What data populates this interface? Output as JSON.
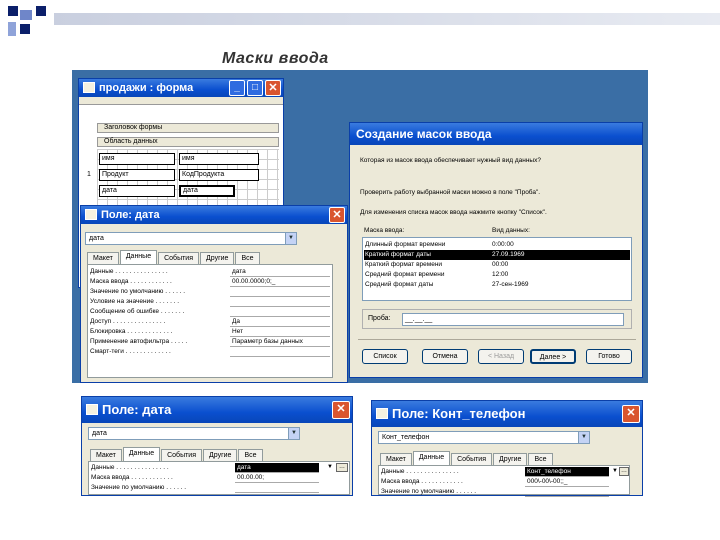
{
  "slide_title": "Маски ввода",
  "form_window": {
    "title": "продажи : форма",
    "min": "_",
    "max": "□",
    "close": "✕",
    "section_header": "Заголовок формы",
    "section_data": "Область данных",
    "rows": [
      {
        "num": "",
        "left": "имя",
        "right": "имя"
      },
      {
        "num": "1",
        "left": "Продукт",
        "right": "КодПродукта"
      },
      {
        "num": "",
        "left": "дата",
        "right": "дата"
      }
    ]
  },
  "mask_wizard": {
    "title": "Создание масок ввода",
    "question": "Которая из масок ввода обеспечивает нужный вид данных?",
    "check_text": "Проверить работу выбранной маски можно в поле \"Проба\".",
    "list_text": "Для изменения списка масок ввода нажмите кнопку \"Список\".",
    "col_mask": "Маска ввода:",
    "col_view": "Вид данных:",
    "rows": [
      {
        "mask": "Длинный формат времени",
        "view": "0:00:00",
        "selected": false
      },
      {
        "mask": "Краткий формат даты",
        "view": "27.09.1969",
        "selected": true
      },
      {
        "mask": "Краткий формат времени",
        "view": "00:00",
        "selected": false
      },
      {
        "mask": "Средний формат времени",
        "view": "12:00",
        "selected": false
      },
      {
        "mask": "Средний формат даты",
        "view": "27-сен-1969",
        "selected": false
      }
    ],
    "try_label": "Проба:",
    "try_value": "__.__.__",
    "buttons": {
      "list": "Список",
      "cancel": "Отмена",
      "back": "< Назад",
      "next": "Далее >",
      "finish": "Готово"
    }
  },
  "field_date_1": {
    "title": "Поле: дата",
    "combo": "дата",
    "tabs": [
      "Макет",
      "Данные",
      "События",
      "Другие",
      "Все"
    ],
    "active_tab": "Данные",
    "props": [
      {
        "label": "Данные . . . . . . . . . . . . . . .",
        "value": "дата"
      },
      {
        "label": "Маска ввода . . . . . . . . . . . .",
        "value": "00.00.0000;0;_"
      },
      {
        "label": "Значение по умолчанию . . . . . .",
        "value": ""
      },
      {
        "label": "Условие на значение . . . . . . .",
        "value": ""
      },
      {
        "label": "Сообщение об ошибке . . . . . . .",
        "value": ""
      },
      {
        "label": "Доступ . . . . . . . . . . . . . . .",
        "value": "Да"
      },
      {
        "label": "Блокировка . . . . . . . . . . . . .",
        "value": "Нет"
      },
      {
        "label": "Применение автофильтра . . . . .",
        "value": "Параметр базы данных"
      },
      {
        "label": "Смарт-теги . . . . . . . . . . . . .",
        "value": ""
      }
    ]
  },
  "field_date_2": {
    "title": "Поле: дата",
    "combo": "дата",
    "tabs": [
      "Макет",
      "Данные",
      "События",
      "Другие",
      "Все"
    ],
    "active_tab": "Данные",
    "props": [
      {
        "label": "Данные . . . . . . . . . . . . . . .",
        "value": "дата"
      },
      {
        "label": "Маска ввода . . . . . . . . . . . .",
        "value": "00.00.00;"
      },
      {
        "label": "Значение по умолчанию . . . . . .",
        "value": ""
      }
    ]
  },
  "field_phone": {
    "title": "Поле: Конт_телефон",
    "combo": "Конт_телефон",
    "tabs": [
      "Макет",
      "Данные",
      "События",
      "Другие",
      "Все"
    ],
    "active_tab": "Данные",
    "props": [
      {
        "label": "Данные . . . . . . . . . . . . . . .",
        "value": "Конт_телефон"
      },
      {
        "label": "Маска ввода . . . . . . . . . . . .",
        "value": "000\\-00\\-00;;_"
      },
      {
        "label": "Значение по умолчанию . . . . . .",
        "value": ""
      }
    ]
  }
}
